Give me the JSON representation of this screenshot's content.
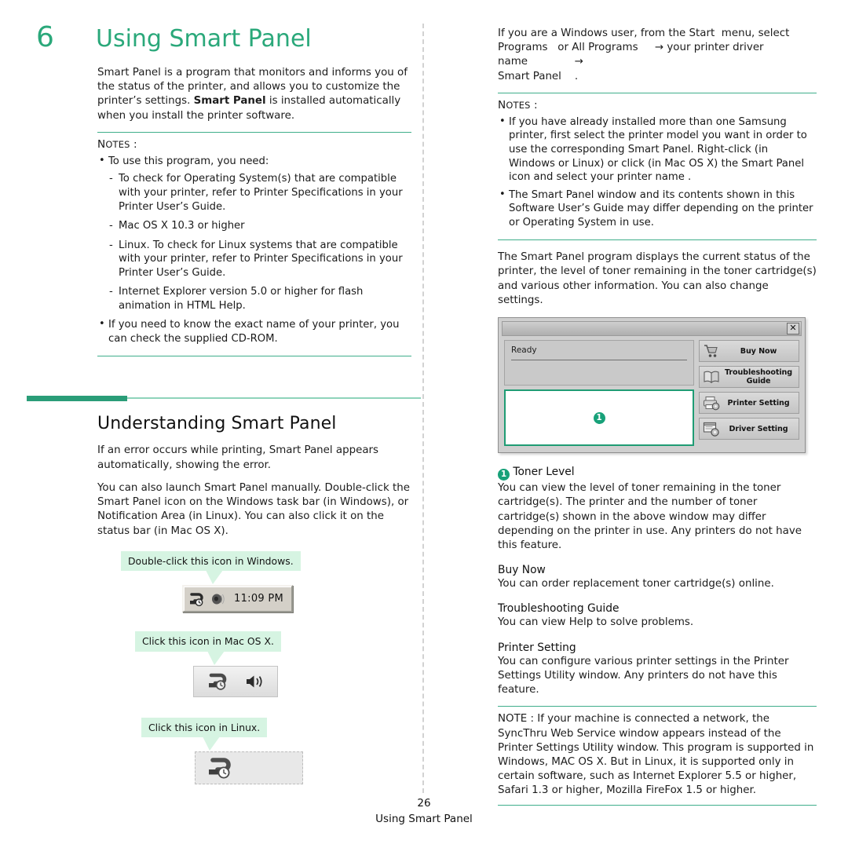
{
  "document": {
    "chapter_number": "6",
    "chapter_title": "Using Smart Panel",
    "accent_green": "#2aa87a",
    "callout_green": "#d6f4e2",
    "rule_green": "#2a9d78"
  },
  "left_column": {
    "intro": "Smart Panel is a program that monitors and informs you of the status of the printer, and allows you to customize the printer’s settings. Smart Panel is installed automatically when you install the printer software.",
    "intro_bold_term": "Smart Panel",
    "notes": {
      "label_cap": "N",
      "label_rest": "OTES",
      "label_colon": " :",
      "items": [
        {
          "text": "To use this program, you need:",
          "subitems": [
            "To check for Operating System(s) that are compatible with your printer, refer to Printer Specifications in your Printer User’s Guide.",
            "Mac OS X 10.3 or higher",
            "Linux. To check for Linux systems that are compatible with your printer, refer to Printer Specifications in your Printer User’s Guide.",
            "Internet Explorer version 5.0 or higher for flash animation in HTML Help."
          ]
        },
        {
          "text": "If you need to know the exact name of your printer, you can check the supplied CD-ROM.",
          "subitems": []
        }
      ]
    },
    "section": {
      "title": "Understanding Smart Panel",
      "paragraph_1": "If an error occurs while printing, Smart Panel appears automatically, showing the error.",
      "paragraph_2": "You can also launch Smart Panel manually. Double-click the Smart Panel icon on the Windows task bar (in Windows), or Notification Area (in Linux). You can also click it on the status bar (in Mac OS X)."
    },
    "callouts": [
      {
        "text": "Double-click this icon in Windows.",
        "tray_type": "windows",
        "tray_time": "11:09 PM",
        "icons": [
          "smart-panel-printer-icon",
          "speaker-icon"
        ]
      },
      {
        "text": "Click this icon in Mac OS X.",
        "tray_type": "mac",
        "tray_time": "",
        "icons": [
          "smart-panel-printer-icon",
          "volume-icon"
        ]
      },
      {
        "text": "Click this icon in Linux.",
        "tray_type": "linux",
        "tray_time": "",
        "icons": [
          "smart-panel-printer-icon"
        ]
      }
    ]
  },
  "right_column": {
    "intro": "If you are a Windows user, from the Start menu, select Programs or All Programs → your printer driver name → Smart Panel .",
    "intro_parts": {
      "a": "If you are a Windows user, from the Start",
      "b": "menu, select",
      "c": "Programs",
      "d": "or All Programs",
      "e": "→ your printer driver name",
      "f": "→",
      "g": "Smart Panel",
      "h": "."
    },
    "notes": {
      "label_cap": "N",
      "label_rest": "OTES",
      "label_colon": " :",
      "items": [
        "If you have already installed more than one Samsung printer, first select the printer model you want in order to use the corresponding Smart Panel. Right-click (in Windows or Linux) or click (in Mac OS X) the Smart Panel icon and select your printer name .",
        "The Smart Panel window and its contents shown in this Software User’s Guide may differ depending on the printer or Operating System in use."
      ]
    },
    "paragraph_after_notes": "The Smart Panel program displays the current status of the printer, the level of toner remaining in the toner cartridge(s) and various other information. You can also change settings.",
    "smart_panel_window": {
      "status_text": "Ready",
      "close_label": "✕",
      "toner_badge": "1",
      "buttons": [
        {
          "label": "Buy Now",
          "icon": "shopping-cart-icon"
        },
        {
          "label": "Troubleshooting Guide",
          "icon": "help-book-icon"
        },
        {
          "label": "Printer Setting",
          "icon": "printer-gear-icon"
        },
        {
          "label": "Driver Setting",
          "icon": "window-gear-icon"
        }
      ]
    },
    "feature_sections": [
      {
        "badge": "1",
        "heading": "Toner Level",
        "body": "You can view the level of toner remaining in the toner cartridge(s). The printer and the number of toner cartridge(s) shown in the above window may differ depending on the printer in use. Any printers do not have this feature."
      },
      {
        "badge": "",
        "heading": "Buy Now",
        "body": "You can order replacement toner cartridge(s) online."
      },
      {
        "badge": "",
        "heading": "Troubleshooting Guide",
        "body": "You can view Help to solve problems."
      },
      {
        "badge": "",
        "heading": "Printer Setting",
        "body": "You can configure various printer settings in the Printer Settings Utility window. Any printers do not have this feature."
      }
    ],
    "final_note": {
      "label_cap": "N",
      "label_rest": "OTE",
      "label_colon": " : ",
      "text": "If your machine is connected a network, the SyncThru Web Service window appears instead of the Printer Settings Utility window. This program is supported in Windows, MAC OS X. But in Linux, it is supported only in certain software, such as Internet Explorer 5.5 or higher, Safari 1.3 or higher, Mozilla FireFox 1.5 or higher."
    }
  },
  "footer": {
    "page_number": "26",
    "running_title": "Using Smart Panel"
  }
}
